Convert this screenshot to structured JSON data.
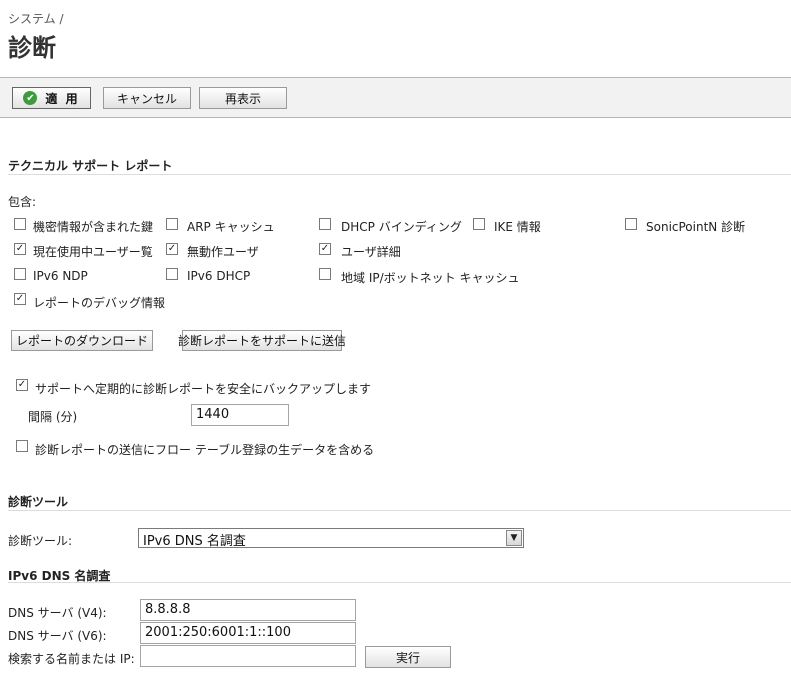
{
  "breadcrumb": "システム /",
  "title": "診断",
  "toolbar": {
    "apply": "適 用",
    "cancel": "キャンセル",
    "refresh": "再表示"
  },
  "tech_support": {
    "section_title": "テクニカル サポート レポート",
    "include_label": "包含:",
    "options": [
      {
        "label": "機密情報が含まれた鍵",
        "checked": false
      },
      {
        "label": "ARP キャッシュ",
        "checked": false
      },
      {
        "label": "DHCP バインディング",
        "checked": false
      },
      {
        "label": "IKE 情報",
        "checked": false
      },
      {
        "label": "SonicPointN 診断",
        "checked": false
      },
      {
        "label": "現在使用中ユーザー覧",
        "checked": true
      },
      {
        "label": "無動作ユーザ",
        "checked": true
      },
      {
        "label": "ユーザ詳細",
        "checked": true
      },
      {
        "label": "IPv6 NDP",
        "checked": false
      },
      {
        "label": "IPv6 DHCP",
        "checked": false
      },
      {
        "label": "地域 IP/ボットネット キャッシュ",
        "checked": false
      },
      {
        "label": "レポートのデバッグ情報",
        "checked": true
      }
    ],
    "download_button": "レポートのダウンロード",
    "send_button": "診断レポートをサポートに送信",
    "periodic_backup": {
      "label": "サポートへ定期的に診断レポートを安全にバックアップします",
      "checked": true
    },
    "interval_label": "間隔 (分)",
    "interval_value": "1440",
    "include_raw": {
      "label": "診断レポートの送信にフロー テーブル登録の生データを含める",
      "checked": false
    }
  },
  "diag_tools": {
    "section_title": "診断ツール",
    "tool_label": "診断ツール:",
    "selected_tool": "IPv6 DNS 名調査"
  },
  "dns_lookup": {
    "section_title": "IPv6 DNS 名調査",
    "dns_v4_label": "DNS サーバ (V4):",
    "dns_v4_value": "8.8.8.8",
    "dns_v6_label": "DNS サーバ (V6):",
    "dns_v6_value": "2001:250:6001:1::100",
    "search_label": "検索する名前または IP:",
    "search_value": "",
    "run_button": "実行"
  }
}
